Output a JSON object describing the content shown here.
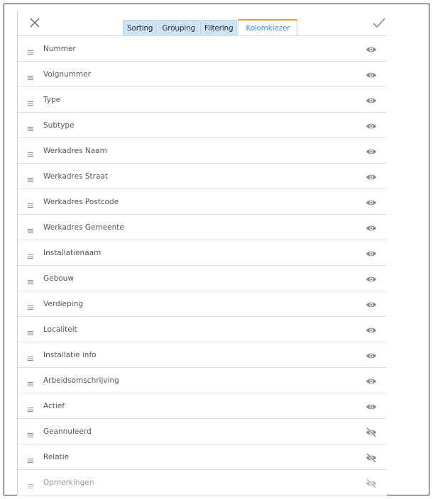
{
  "tabs": [
    {
      "label": "Sorting",
      "active": false
    },
    {
      "label": "Grouping",
      "active": false
    },
    {
      "label": "Filtering",
      "active": false
    },
    {
      "label": "Kolomkiezer",
      "active": true
    }
  ],
  "icons": {
    "close": "close-icon",
    "confirm": "checkmark-icon",
    "drag": "drag-handle-icon",
    "visible": "eye-icon",
    "hidden": "eye-slash-icon"
  },
  "colors": {
    "tab_bg": "#cfe4f5",
    "active_tab_text": "#3d8fd6",
    "active_tab_accent": "#f0a030",
    "icon": "#888888"
  },
  "columns": [
    {
      "label": "Nummer",
      "visible": true
    },
    {
      "label": "Volgnummer",
      "visible": true
    },
    {
      "label": "Type",
      "visible": true
    },
    {
      "label": "Subtype",
      "visible": true
    },
    {
      "label": "Werkadres Naam",
      "visible": true
    },
    {
      "label": "Werkadres Straat",
      "visible": true
    },
    {
      "label": "Werkadres Postcode",
      "visible": true
    },
    {
      "label": "Werkadres Gemeente",
      "visible": true
    },
    {
      "label": "Installatienaam",
      "visible": true
    },
    {
      "label": "Gebouw",
      "visible": true
    },
    {
      "label": "Verdieping",
      "visible": true
    },
    {
      "label": "Localiteit",
      "visible": true
    },
    {
      "label": "Installatie info",
      "visible": true
    },
    {
      "label": "Arbeidsomschrijving",
      "visible": true
    },
    {
      "label": "Actief",
      "visible": true
    },
    {
      "label": "Geannuleerd",
      "visible": false
    },
    {
      "label": "Relatie",
      "visible": false
    },
    {
      "label": "Opmerkingen",
      "visible": false
    }
  ]
}
